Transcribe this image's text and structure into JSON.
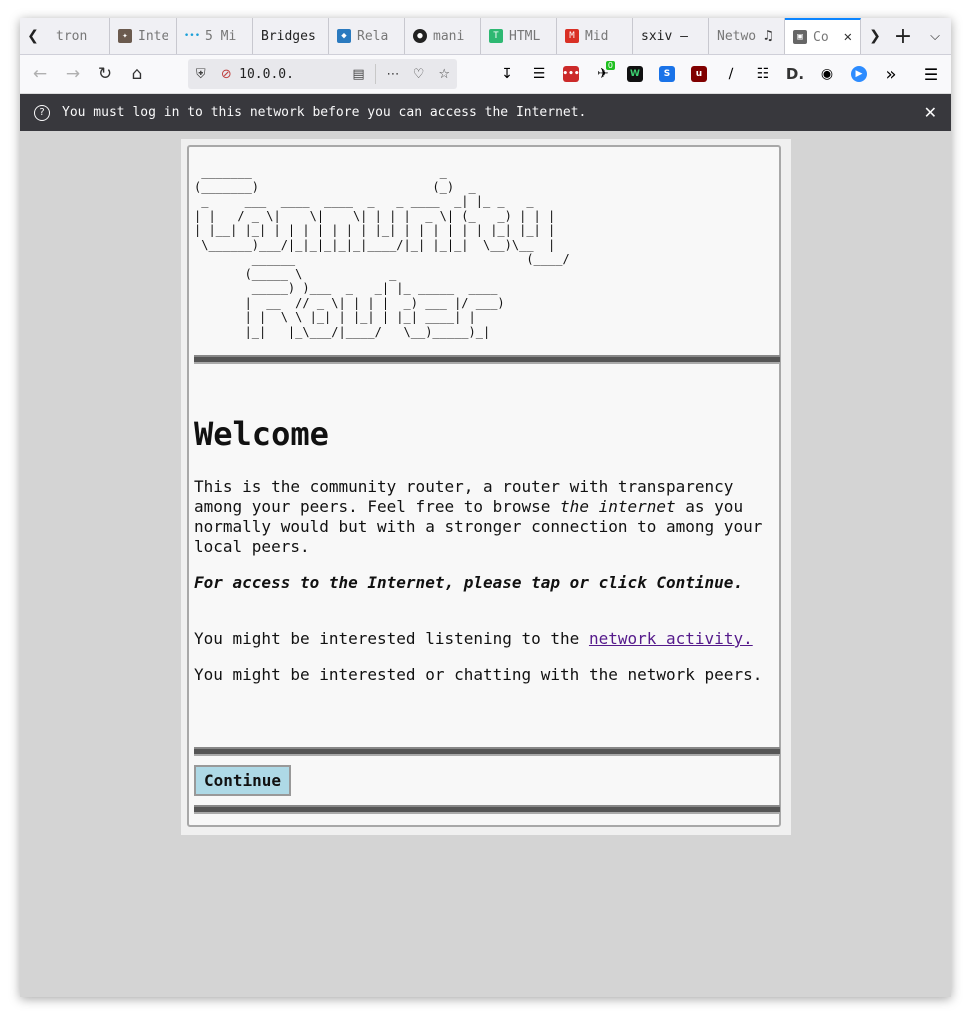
{
  "tabs": [
    {
      "label": "tron",
      "fav": "",
      "favcolor": "",
      "w": 62,
      "fade": true
    },
    {
      "label": "Inte",
      "fav": "puzzle",
      "favcolor": "#6b5a4e",
      "w": 67,
      "fade": true
    },
    {
      "label": "5 Mi",
      "fav": "dots",
      "favcolor": "#1aa0d8",
      "w": 76,
      "fade": true
    },
    {
      "label": "Bridges",
      "fav": "",
      "favcolor": "",
      "w": 76,
      "fade": false
    },
    {
      "label": "Rela",
      "fav": "bird",
      "favcolor": "#2a7abf",
      "w": 76,
      "fade": true
    },
    {
      "label": "mani",
      "fav": "github",
      "favcolor": "#222222",
      "w": 76,
      "fade": true
    },
    {
      "label": "HTML",
      "fav": "T",
      "favcolor": "#2eb872",
      "w": 76,
      "fade": true
    },
    {
      "label": "Mid",
      "fav": "M",
      "favcolor": "#d93025",
      "w": 76,
      "fade": true
    },
    {
      "label": "sxiv –",
      "fav": "",
      "favcolor": "",
      "w": 76,
      "fade": false
    },
    {
      "label": "Netwo",
      "fav": "",
      "favcolor": "",
      "w": 76,
      "fade": true,
      "audio": true
    },
    {
      "label": "Co",
      "fav": "img",
      "favcolor": "#666666",
      "w": 76,
      "fade": true,
      "active": true
    }
  ],
  "navbar": {
    "url": "10.0.0."
  },
  "notification": {
    "message": "You must log in to this network before you can access the Internet."
  },
  "page": {
    "ascii_art": " _______                          _\n(_______)                        (_)  _\n _     ___  ____  ____  _   _ ____  _| |_ _   _\n| |   / _ \\|    \\|    \\| | | |  _ \\| (_   _) | | |\n| |__| |_| | | | | | | | |_| | | | | | | |_| |_| |\n \\______)___/|_|_|_|_|_|____/|_| |_|_|  \\__)\\__  |\n        ______                                (____/\n       (_____ \\            _\n        _____) )___  _   _| |_ _____  ____\n       |  __  // _ \\| | | |  _) ___ |/ ___)\n       | |  \\ \\ |_| | |_| | |_| ____| |\n       |_|   |_\\___/|____/   \\__)_____)_|",
    "heading": "Welcome",
    "intro_1": "This is the community router, a router with transparency among your peers. Feel free to browse ",
    "intro_em": "the internet",
    "intro_2": " as you normally would but with a stronger connection to among your local peers.",
    "access_text": "For access to the Internet, please tap or click Continue.",
    "activity_prefix": "You might be interested listening to the ",
    "activity_link": "network activity.",
    "chat_text": "You might be interested or chatting with the network peers.",
    "continue_label": "Continue"
  }
}
